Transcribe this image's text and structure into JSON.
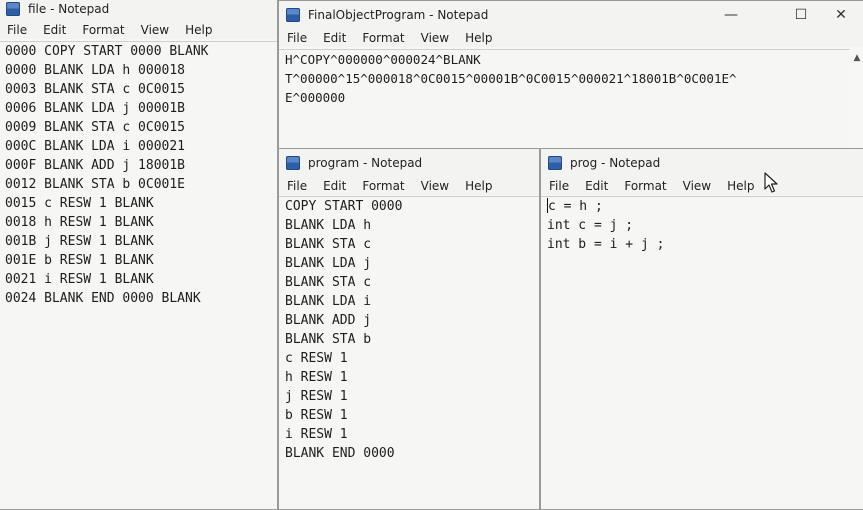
{
  "windows": {
    "file": {
      "title": "file - Notepad",
      "menu": [
        "File",
        "Edit",
        "Format",
        "View",
        "Help"
      ],
      "lines": [
        "0000 COPY START 0000 BLANK",
        "0000 BLANK LDA h 000018",
        "0003 BLANK STA c 0C0015",
        "0006 BLANK LDA j 00001B",
        "0009 BLANK STA c 0C0015",
        "000C BLANK LDA i 000021",
        "000F BLANK ADD j 18001B",
        "0012 BLANK STA b 0C001E",
        "0015 c RESW 1 BLANK",
        "0018 h RESW 1 BLANK",
        "001B j RESW 1 BLANK",
        "001E b RESW 1 BLANK",
        "0021 i RESW 1 BLANK",
        "0024 BLANK END 0000 BLANK"
      ]
    },
    "final": {
      "title": "FinalObjectProgram - Notepad",
      "menu": [
        "File",
        "Edit",
        "Format",
        "View",
        "Help"
      ],
      "lines": [
        "H^COPY^000000^000024^BLANK",
        "T^00000^15^000018^0C0015^00001B^0C0015^000021^18001B^0C001E^",
        "E^000000"
      ],
      "controls": {
        "minimize": "—",
        "maximize": "☐",
        "close": "✕"
      }
    },
    "program": {
      "title": "program - Notepad",
      "menu": [
        "File",
        "Edit",
        "Format",
        "View",
        "Help"
      ],
      "lines": [
        "COPY START 0000",
        "BLANK LDA h",
        "BLANK STA c",
        "BLANK LDA j",
        "BLANK STA c",
        "BLANK LDA i",
        "BLANK ADD j",
        "BLANK STA b",
        "c RESW 1",
        "h RESW 1",
        "j RESW 1",
        "b RESW 1",
        "i RESW 1",
        "BLANK END 0000"
      ]
    },
    "prog": {
      "title": "prog - Notepad",
      "menu": [
        "File",
        "Edit",
        "Format",
        "View",
        "Help"
      ],
      "lines": [
        "c = h ;",
        "int c = j ;",
        "int b = i + j ;"
      ]
    }
  },
  "icons": {
    "notepad": "notepad-icon",
    "cursor": "mouse-cursor-icon"
  },
  "colors": {
    "desktop": "#b9b9b7",
    "window_bg": "#f7f7f5",
    "text": "#1d1d1d"
  }
}
